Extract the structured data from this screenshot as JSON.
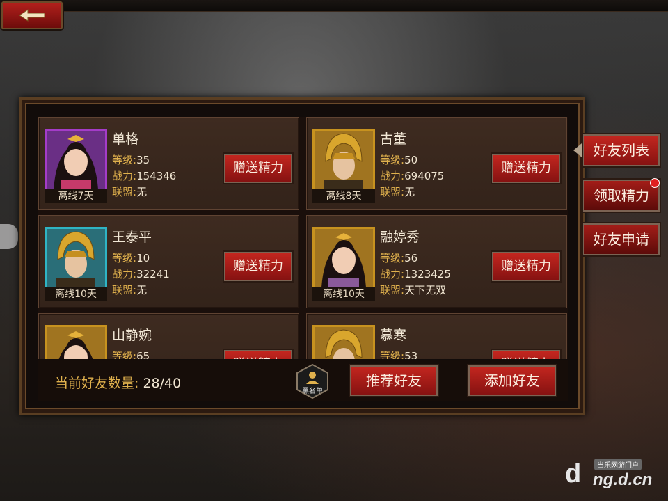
{
  "header": {
    "back_icon": "back-arrow-icon"
  },
  "tabs": [
    {
      "label": "好友列表",
      "active": true
    },
    {
      "label": "领取精力",
      "active": false,
      "badge": true
    },
    {
      "label": "好友申请",
      "active": false
    }
  ],
  "stat_labels": {
    "level": "等级:",
    "power": "战力:",
    "alliance": "联盟:"
  },
  "gift_label": "赠送精力",
  "friends": [
    {
      "name": "单格",
      "level": "35",
      "power": "154346",
      "alliance": "无",
      "offline": "离线7天",
      "frame_color": "#a43cc8",
      "portrait": "female"
    },
    {
      "name": "古董",
      "level": "50",
      "power": "694075",
      "alliance": "无",
      "offline": "离线8天",
      "frame_color": "#c7921f",
      "portrait": "male"
    },
    {
      "name": "王泰平",
      "level": "10",
      "power": "32241",
      "alliance": "无",
      "offline": "离线10天",
      "frame_color": "#2fb4c4",
      "portrait": "male"
    },
    {
      "name": "融婷秀",
      "level": "56",
      "power": "1323425",
      "alliance": "天下无双",
      "offline": "离线10天",
      "frame_color": "#c7921f",
      "portrait": "female"
    },
    {
      "name": "山静婉",
      "level": "65",
      "portrait": "female",
      "frame_color": "#c7921f"
    },
    {
      "name": "慕寒",
      "level": "53",
      "portrait": "male",
      "frame_color": "#c7921f"
    }
  ],
  "footer": {
    "count_label": "当前好友数量:",
    "count_value": "28/40",
    "blacklist_label": "黑名单",
    "recommend_label": "推荐好友",
    "add_label": "添加好友"
  },
  "watermark": {
    "small": "当乐网游门户",
    "big": "ng.d.cn"
  }
}
